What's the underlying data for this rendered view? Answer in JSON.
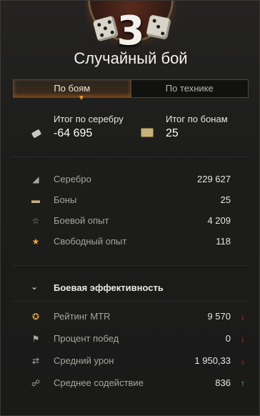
{
  "header": {
    "rank_number": "3",
    "title": "Случайный бой"
  },
  "tabs": [
    {
      "label": "По боям",
      "active": true
    },
    {
      "label": "По технике",
      "active": false
    }
  ],
  "totals": {
    "silver": {
      "label": "Итог по серебру",
      "value": "-64 695",
      "icon": "silver-icon"
    },
    "bonds": {
      "label": "Итог по бонам",
      "value": "25",
      "icon": "bonds-icon"
    }
  },
  "earnings": [
    {
      "label": "Серебро",
      "value": "229 627",
      "icon": "silver-icon"
    },
    {
      "label": "Боны",
      "value": "25",
      "icon": "bonds-icon"
    },
    {
      "label": "Боевой опыт",
      "value": "4 209",
      "icon": "star-outline-icon"
    },
    {
      "label": "Свободный опыт",
      "value": "118",
      "icon": "star-gold-icon"
    }
  ],
  "efficiency": {
    "title": "Боевая эффективность",
    "rows": [
      {
        "label": "Рейтинг MTR",
        "value": "9 570",
        "trend": "down",
        "icon": "rating-emblem-icon"
      },
      {
        "label": "Процент побед",
        "value": "0",
        "trend": "down",
        "icon": "flag-icon"
      },
      {
        "label": "Средний урон",
        "value": "1 950,33",
        "trend": "down",
        "icon": "damage-icon"
      },
      {
        "label": "Среднее содействие",
        "value": "836",
        "trend": "up",
        "icon": "assist-icon"
      }
    ]
  },
  "colors": {
    "trend_down": "#e0342c",
    "trend_up": "#4fd06a",
    "accent": "#f39a2c"
  }
}
